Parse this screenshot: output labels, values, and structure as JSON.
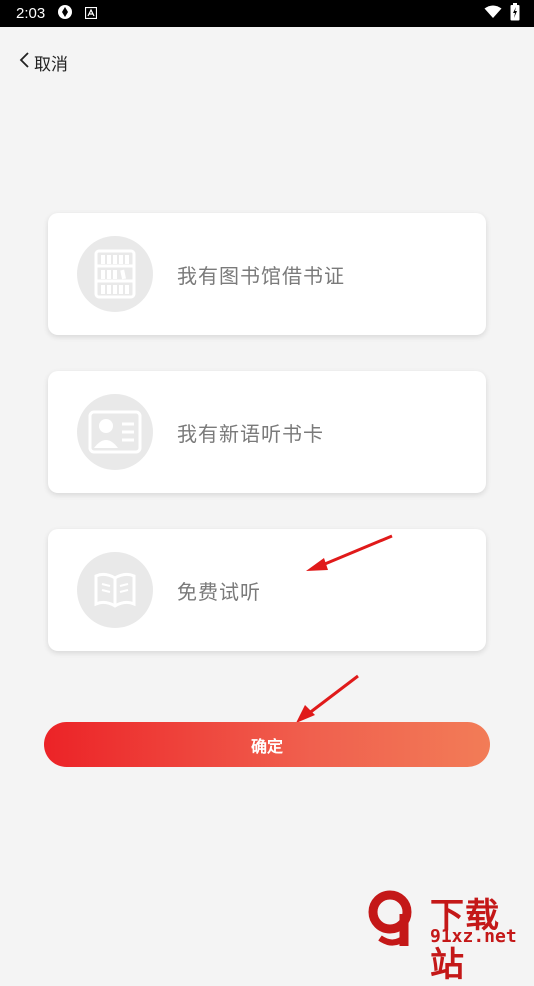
{
  "status_bar": {
    "time": "2:03"
  },
  "nav": {
    "back_label": "取消"
  },
  "options": [
    {
      "label": "我有图书馆借书证",
      "icon": "library-card-icon"
    },
    {
      "label": "我有新语听书卡",
      "icon": "id-card-icon"
    },
    {
      "label": "免费试听",
      "icon": "open-book-icon"
    }
  ],
  "confirm": {
    "label": "确定"
  },
  "watermark": {
    "logo_text": "下载站",
    "url": "91xz.net"
  },
  "colors": {
    "accent_start": "#ec2327",
    "accent_end": "#f27c57",
    "annotation_arrow": "#e01a1a",
    "icon_circle": "#e9e9e9"
  }
}
